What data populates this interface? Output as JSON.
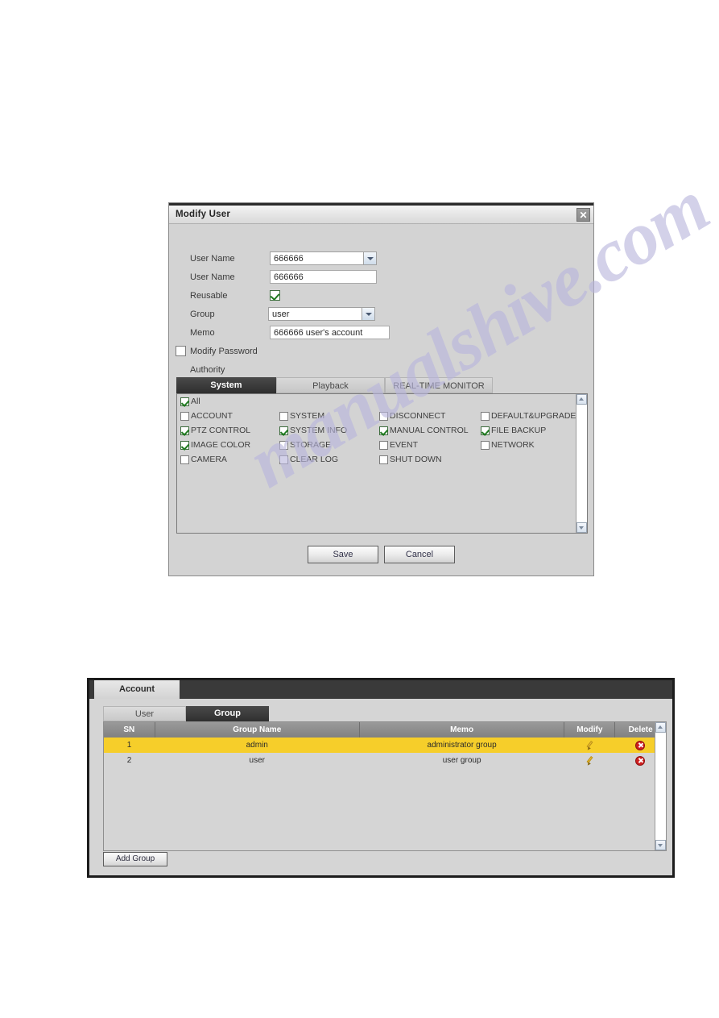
{
  "watermark": {
    "text": "manualshive.com"
  },
  "dialog": {
    "title": "Modify User",
    "close_icon": "close-icon",
    "fields": {
      "user_select_label": "User Name",
      "user_select_value": "666666",
      "user_name_label": "User Name",
      "user_name_value": "666666",
      "reusable_label": "Reusable",
      "reusable_checked": true,
      "group_label": "Group",
      "group_value": "user",
      "memo_label": "Memo",
      "memo_value": "666666 user's account",
      "modify_password_label": "Modify Password",
      "modify_password_checked": false,
      "authority_label": "Authority"
    },
    "tabs": [
      {
        "label": "System",
        "active": true
      },
      {
        "label": "Playback",
        "active": false
      },
      {
        "label": "REAL-TIME MONITOR",
        "active": false
      }
    ],
    "permissions": {
      "all_label": "All",
      "all_checked": true,
      "columns": [
        [
          {
            "label": "ACCOUNT",
            "checked": false
          },
          {
            "label": "PTZ CONTROL",
            "checked": true
          },
          {
            "label": "IMAGE COLOR",
            "checked": true
          },
          {
            "label": "CAMERA",
            "checked": false
          }
        ],
        [
          {
            "label": "SYSTEM",
            "checked": false
          },
          {
            "label": "SYSTEM INFO",
            "checked": true
          },
          {
            "label": "STORAGE",
            "checked": false
          },
          {
            "label": "CLEAR LOG",
            "checked": false
          }
        ],
        [
          {
            "label": "DISCONNECT",
            "checked": false
          },
          {
            "label": "MANUAL CONTROL",
            "checked": true
          },
          {
            "label": "EVENT",
            "checked": false
          },
          {
            "label": "SHUT DOWN",
            "checked": false
          }
        ],
        [
          {
            "label": "DEFAULT&UPGRADE",
            "checked": false
          },
          {
            "label": "FILE BACKUP",
            "checked": true
          },
          {
            "label": "NETWORK",
            "checked": false
          }
        ]
      ]
    },
    "buttons": {
      "save": "Save",
      "cancel": "Cancel"
    }
  },
  "account": {
    "tab_label": "Account",
    "sub_tabs": [
      {
        "label": "User",
        "active": false
      },
      {
        "label": "Group",
        "active": true
      }
    ],
    "table": {
      "headers": [
        "SN",
        "Group Name",
        "Memo",
        "Modify",
        "Delete"
      ],
      "rows": [
        {
          "sn": "1",
          "group_name": "admin",
          "memo": "administrator group",
          "selected": true
        },
        {
          "sn": "2",
          "group_name": "user",
          "memo": "user group",
          "selected": false
        }
      ]
    },
    "add_group_label": "Add Group"
  },
  "colors": {
    "selected_row": "#f6ce2a",
    "header_dark": "#3a3a3a",
    "table_header": "#8e8e8e",
    "delete_red": "#cf1f1f",
    "check_green": "#1f7a1f"
  }
}
